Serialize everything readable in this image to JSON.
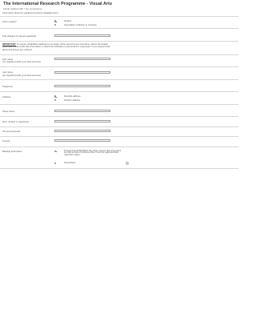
{
  "header": {
    "title": "The International Research Programme - Visual Arts",
    "subtitle": "Fields marked with * are compulsory"
  },
  "intro": "Information about the applicant (Liquid to-data@service)",
  "how_apply": {
    "label": "How to apply?",
    "options": [
      "Student",
      "Associated, institution or company"
    ],
    "selected": 0
  },
  "name_project": {
    "label": "Title (Subject of Interest applicant)"
  },
  "important": {
    "prefix": "IMPORTANT:",
    "text": " To ensure rehabilitate applicant on a single online account your username, where the details legitimate enlisted with this information, in which the institution is accounted in expressed. If you suspect that alerts and issues are outlined."
  },
  "first_name": {
    "label": "First name",
    "sublabel": "(As registered with your bank account)"
  },
  "last_name": {
    "label": "Last name",
    "sublabel": "(As registered with your bank account)"
  },
  "telephone": {
    "label": "Telephone"
  },
  "address": {
    "label": "Address",
    "options": [
      "Domicile address",
      "Postbox address"
    ],
    "selected": 0
  },
  "street_name": {
    "label": "Street name"
  },
  "house_number": {
    "label": "Door number or apartment"
  },
  "city": {
    "label": "City and postcode"
  },
  "country": {
    "label": "Country"
  },
  "banking": {
    "label": "Banking information",
    "options": [
      "Through internal BIC/IBAN. Pay nicely connect, fill in and submit the internet bank of institution when I sent the legitimate Bank registration pages.",
      "Somewhere"
    ],
    "selected": 0
  },
  "icons": {
    "info": "info-icon"
  },
  "colors": {
    "border": "#9c9c9c",
    "divider": "#d6d6d6",
    "text": "#333333"
  }
}
